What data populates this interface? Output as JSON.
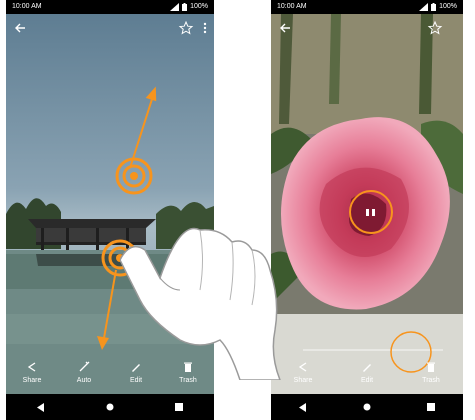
{
  "left_phone": {
    "status": {
      "time": "10:00 AM",
      "battery": "100%"
    },
    "actions": [
      {
        "label": "Share",
        "icon": "share-icon"
      },
      {
        "label": "Auto",
        "icon": "auto-enhance-icon"
      },
      {
        "label": "Edit",
        "icon": "edit-icon"
      },
      {
        "label": "Trash",
        "icon": "trash-icon"
      }
    ]
  },
  "right_phone": {
    "status": {
      "time": "10:00 AM",
      "battery": "100%"
    },
    "actions": [
      {
        "label": "Share",
        "icon": "share-icon"
      },
      {
        "label": "Edit",
        "icon": "edit-icon"
      },
      {
        "label": "Trash",
        "icon": "trash-icon"
      }
    ]
  },
  "gesture_colors": {
    "accent": "#f7941d"
  }
}
